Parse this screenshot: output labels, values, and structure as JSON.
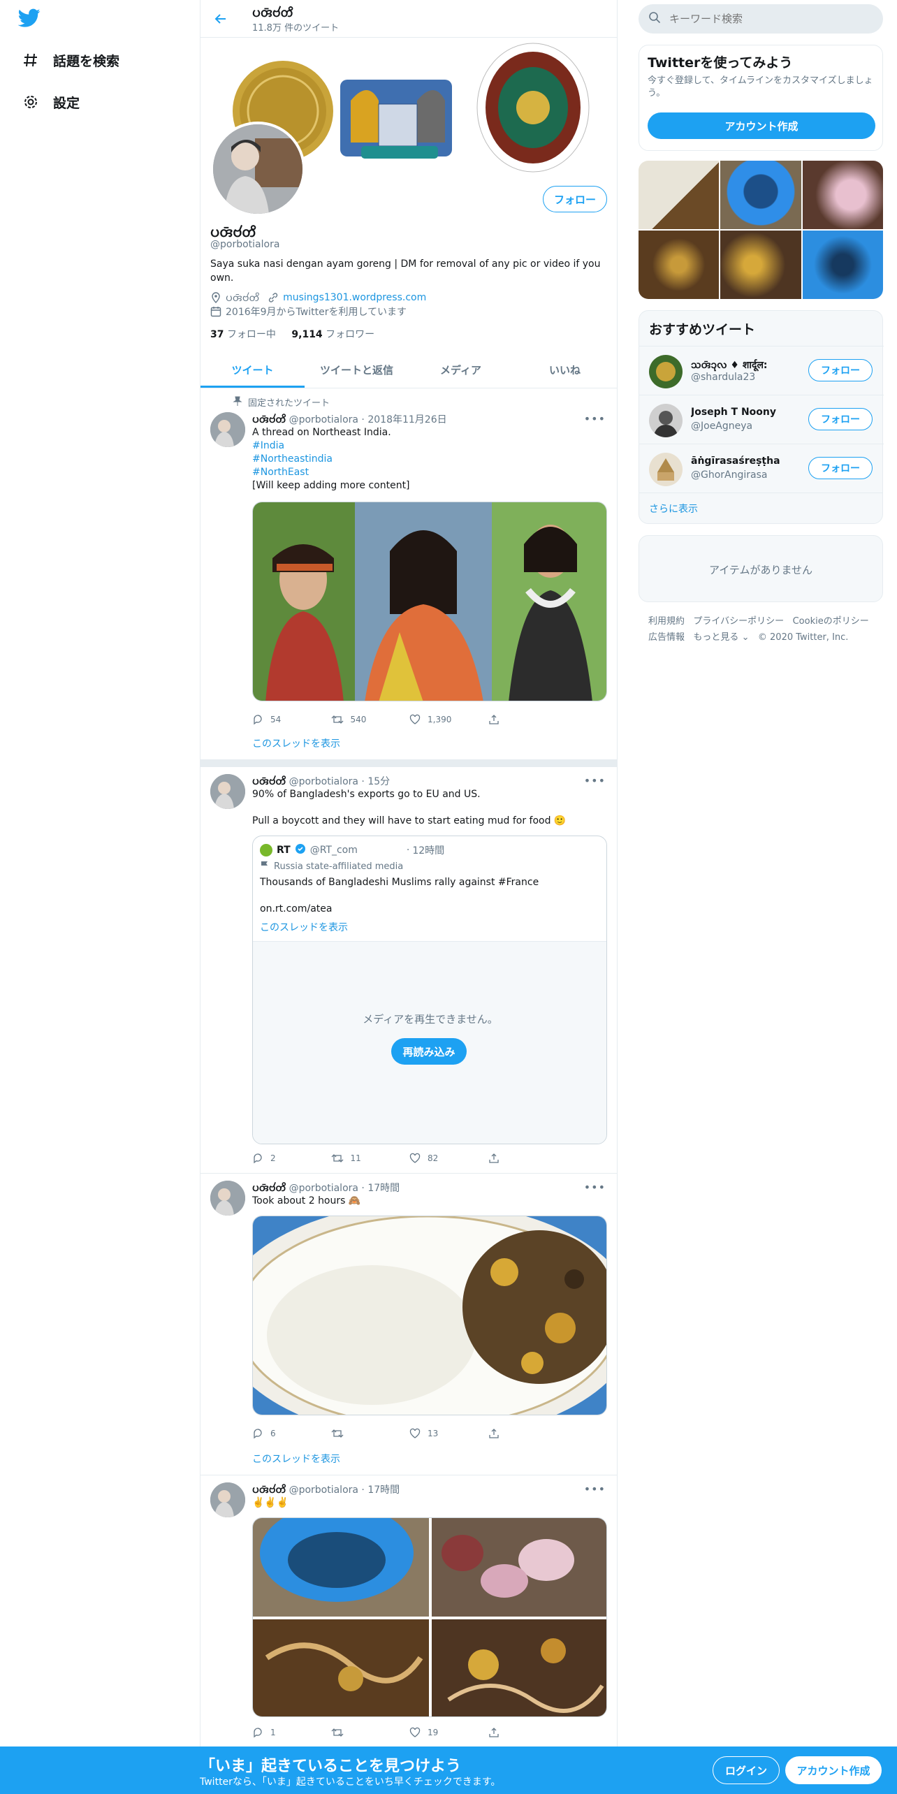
{
  "nav": {
    "explore_label": "話題を検索",
    "settings_label": "設定"
  },
  "header": {
    "name": "𑄛𑄢𑄴𑄝𑄧𑄖𑄨",
    "tweet_count": "11.8万 件のツイート"
  },
  "profile": {
    "name": "𑄛𑄢𑄴𑄝𑄧𑄖𑄨",
    "handle": "@porbotialora",
    "bio": "Saya suka nasi dengan ayam goreng | DM for removal of any pic or video if you own.",
    "location": "𑄛𑄢𑄴𑄝𑄧𑄖𑄨",
    "website": "musings1301.wordpress.com",
    "joined": "2016年9月からTwitterを利用しています",
    "following_count": "37",
    "following_label": "フォロー中",
    "followers_count": "9,114",
    "followers_label": "フォロワー",
    "follow_label": "フォロー"
  },
  "tabs": [
    "ツイート",
    "ツイートと返信",
    "メディア",
    "いいね"
  ],
  "tweets": [
    {
      "pinned_label": "固定されたツイート",
      "name": "𑄛𑄢𑄴𑄝𑄧𑄖𑄨",
      "handle": "@porbotialora",
      "time": "2018年11月26日",
      "lines": [
        "A thread on Northeast India.",
        "#India",
        "#Northeastindia",
        "#NorthEast",
        "[Will keep adding more content]"
      ],
      "replies": "54",
      "retweets": "540",
      "likes": "1,390",
      "show_thread": "このスレッドを表示"
    },
    {
      "name": "𑄛𑄢𑄴𑄝𑄧𑄖𑄨",
      "handle": "@porbotialora",
      "time": "15分",
      "line1": "90% of Bangladesh's exports go to EU and US.",
      "line2": "Pull a boycott and they will have to start eating mud for food 🙂",
      "quote": {
        "name": "RT",
        "handle": "@RT_com",
        "time": "12時間",
        "affiliation": "Russia state-affiliated media",
        "text": "Thousands of Bangladeshi Muslims rally against #France",
        "link": "on.rt.com/atea",
        "show_thread": "このスレッドを表示",
        "media_error": "メディアを再生できません。",
        "reload": "再読み込み"
      },
      "replies": "2",
      "retweets": "11",
      "likes": "82"
    },
    {
      "name": "𑄛𑄢𑄴𑄝𑄧𑄖𑄨",
      "handle": "@porbotialora",
      "time": "17時間",
      "text": "Took about 2 hours 🙈",
      "replies": "6",
      "retweets": "",
      "likes": "13",
      "show_thread": "このスレッドを表示"
    },
    {
      "name": "𑄛𑄢𑄴𑄝𑄧𑄖𑄨",
      "handle": "@porbotialora",
      "time": "17時間",
      "text": "✌️✌️✌️",
      "replies": "1",
      "retweets": "",
      "likes": "19"
    }
  ],
  "sidebar": {
    "search_placeholder": "キーワード検索",
    "signup_title": "Twitterを使ってみよう",
    "signup_desc": "今すぐ登録して、タイムラインをカスタマイズしましょう。",
    "signup_button": "アカウント作成",
    "suggest_title": "おすすめツイート",
    "suggestions": [
      {
        "name": "𑄥𑄢𑄴𑄘𑄪𑄣 ♦ शार्दूल:",
        "handle": "@shardula23",
        "follow": "フォロー"
      },
      {
        "name": "Joseph T Noony",
        "handle": "@JoeAgneya",
        "follow": "フォロー"
      },
      {
        "name": "āṅgīrasaśreṣṭha",
        "handle": "@GhorAngirasa",
        "follow": "フォロー"
      }
    ],
    "show_more": "さらに表示",
    "no_items": "アイテムがありません",
    "footer": [
      "利用規約",
      "プライバシーポリシー",
      "Cookieのポリシー",
      "広告情報",
      "もっと見る",
      "© 2020 Twitter, Inc."
    ]
  },
  "bottom_bar": {
    "title": "「いま」起きていることを見つけよう",
    "subtitle": "Twitterなら、「いま」起きていることをいち早くチェックできます。",
    "login": "ログイン",
    "signup": "アカウント作成"
  },
  "colors": {
    "accent": "#1da1f2",
    "border": "#e6ecf0",
    "muted": "#657786"
  }
}
